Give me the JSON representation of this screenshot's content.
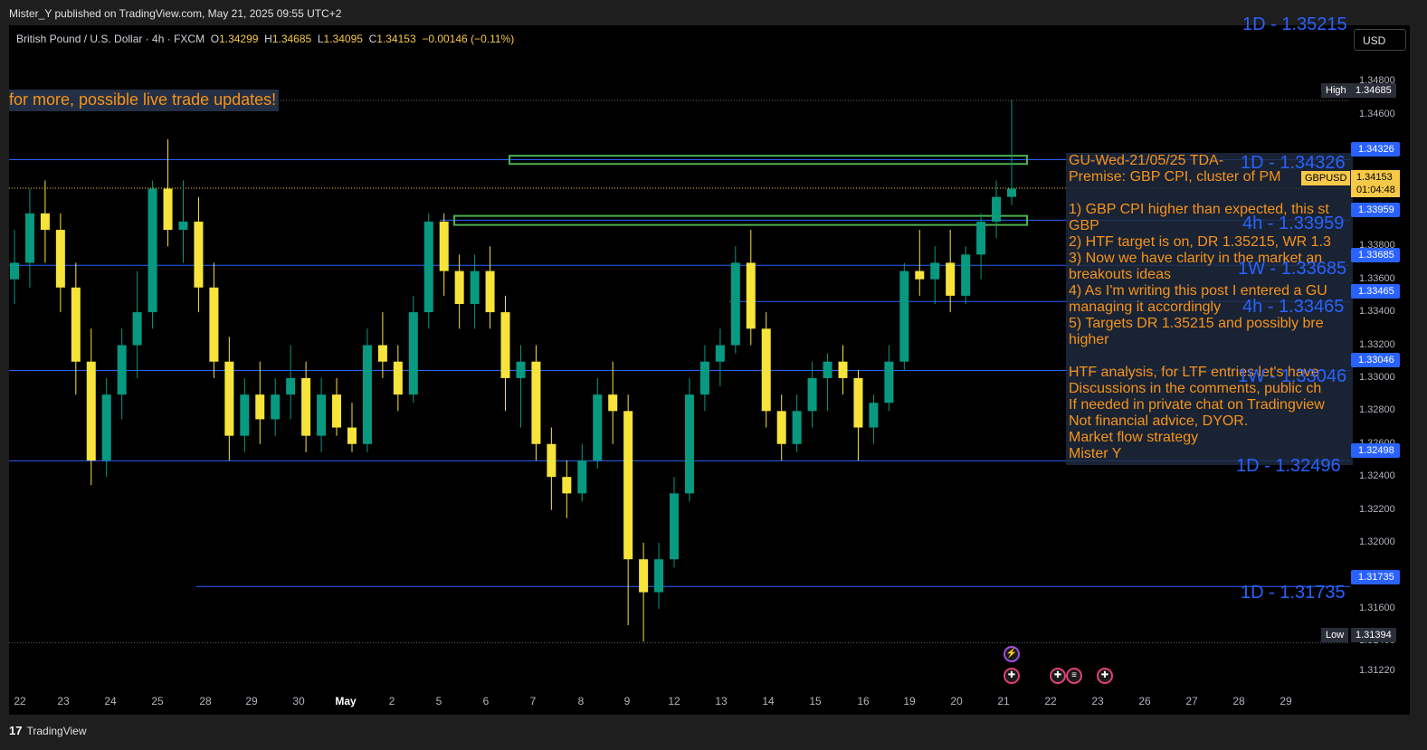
{
  "header": {
    "publisher_text": "Mister_Y published on TradingView.com, May 21, 2025 09:55 UTC+2"
  },
  "footer": {
    "logo_text": "TradingView",
    "logo_mark": "17"
  },
  "legend": {
    "symbol": "British Pound / U.S. Dollar · 4h · FXCM",
    "open": "1.34299",
    "high": "1.34685",
    "low": "1.34095",
    "close": "1.34153",
    "change": "−0.00146 (−0.11%)"
  },
  "currency_button": "USD",
  "promo_text": "for more, possible live trade updates!",
  "note": {
    "lines": [
      "GU-Wed-21/05/25 TDA-",
      "Premise: GBP CPI, cluster of PM",
      "",
      "1) GBP CPI higher than expected, this st",
      "GBP",
      "2) HTF target is on, DR 1.35215, WR 1.3",
      "3) Now we have clarity in the market an",
      "breakouts ideas",
      "4) As I'm writing this post I entered a GU",
      "managing it accordingly",
      "5) Targets DR 1.35215 and possibly bre",
      "higher",
      "",
      "HTF analysis, for LTF entries let's have",
      "Discussions in the comments, public ch",
      "If needed in private chat on Tradingview",
      "Not financial advice, DYOR.",
      "Market flow strategy",
      "Mister Y"
    ]
  },
  "level_labels": [
    {
      "text": "1D - 1.34326"
    },
    {
      "text": "4h - 1.33959"
    },
    {
      "text": "1W - 1.33685"
    },
    {
      "text": "4h - 1.33465"
    },
    {
      "text": "1W - 1.33046"
    },
    {
      "text": "1D - 1.32496"
    },
    {
      "text": "1D - 1.31735"
    },
    {
      "text": "1D - 1.35215"
    }
  ],
  "price_axis": {
    "ticks": [
      "1.34800",
      "1.34600",
      "1.34400",
      "1.34200",
      "1.34000",
      "1.33800",
      "1.33600",
      "1.33400",
      "1.33200",
      "1.33000",
      "1.32800",
      "1.32600",
      "1.32400",
      "1.32200",
      "1.32000",
      "1.31800",
      "1.31600",
      "1.31400",
      "1.31220"
    ],
    "tags": [
      "1.34326",
      "1.33959",
      "1.33685",
      "1.33465",
      "1.33046",
      "1.32498",
      "1.31735"
    ],
    "high_label": "High",
    "high_value": "1.34685",
    "low_label": "Low",
    "low_value": "1.31394",
    "symbol_tag": "GBPUSD",
    "current_price": "1.34153",
    "countdown": "01:04:48"
  },
  "time_axis": [
    "22",
    "23",
    "24",
    "25",
    "28",
    "29",
    "30",
    "May",
    "2",
    "5",
    "6",
    "7",
    "8",
    "9",
    "12",
    "13",
    "14",
    "15",
    "16",
    "19",
    "20",
    "21",
    "22",
    "23",
    "26",
    "27",
    "28",
    "29"
  ],
  "colors": {
    "bull": "#089981",
    "bear": "#f7e43a",
    "level": "#2962ff",
    "zone": "#4caf50",
    "accent": "#f7931a"
  },
  "chart_data": {
    "type": "candlestick",
    "title": "British Pound / U.S. Dollar · 4h · FXCM",
    "ylim": [
      1.3122,
      1.349
    ],
    "x_labels": [
      "22",
      "23",
      "24",
      "25",
      "28",
      "29",
      "30",
      "May",
      "2",
      "5",
      "6",
      "7",
      "8",
      "9",
      "12",
      "13",
      "14",
      "15",
      "16",
      "19",
      "20",
      "21"
    ],
    "ohlc_estimated": [
      [
        1.336,
        1.339,
        1.3345,
        1.337
      ],
      [
        1.337,
        1.3415,
        1.3355,
        1.34
      ],
      [
        1.34,
        1.342,
        1.337,
        1.339
      ],
      [
        1.339,
        1.34,
        1.334,
        1.3355
      ],
      [
        1.3355,
        1.337,
        1.329,
        1.331
      ],
      [
        1.331,
        1.333,
        1.3235,
        1.325
      ],
      [
        1.325,
        1.33,
        1.324,
        1.329
      ],
      [
        1.329,
        1.333,
        1.3275,
        1.332
      ],
      [
        1.332,
        1.3365,
        1.33,
        1.334
      ],
      [
        1.334,
        1.342,
        1.333,
        1.3415
      ],
      [
        1.3415,
        1.3445,
        1.338,
        1.339
      ],
      [
        1.339,
        1.342,
        1.337,
        1.3395
      ],
      [
        1.3395,
        1.341,
        1.334,
        1.3355
      ],
      [
        1.3355,
        1.337,
        1.33,
        1.331
      ],
      [
        1.331,
        1.3325,
        1.325,
        1.3265
      ],
      [
        1.3265,
        1.33,
        1.3255,
        1.329
      ],
      [
        1.329,
        1.331,
        1.326,
        1.3275
      ],
      [
        1.3275,
        1.33,
        1.3265,
        1.329
      ],
      [
        1.329,
        1.332,
        1.3275,
        1.33
      ],
      [
        1.33,
        1.331,
        1.3255,
        1.3265
      ],
      [
        1.3265,
        1.33,
        1.3255,
        1.329
      ],
      [
        1.329,
        1.33,
        1.3265,
        1.327
      ],
      [
        1.327,
        1.3285,
        1.3255,
        1.326
      ],
      [
        1.326,
        1.333,
        1.3255,
        1.332
      ],
      [
        1.332,
        1.334,
        1.33,
        1.331
      ],
      [
        1.331,
        1.332,
        1.328,
        1.329
      ],
      [
        1.329,
        1.335,
        1.3285,
        1.334
      ],
      [
        1.334,
        1.34,
        1.333,
        1.3395
      ],
      [
        1.3395,
        1.34,
        1.335,
        1.3365
      ],
      [
        1.3365,
        1.3375,
        1.333,
        1.3345
      ],
      [
        1.3345,
        1.3375,
        1.333,
        1.3365
      ],
      [
        1.3365,
        1.338,
        1.333,
        1.334
      ],
      [
        1.334,
        1.335,
        1.328,
        1.33
      ],
      [
        1.33,
        1.332,
        1.327,
        1.331
      ],
      [
        1.331,
        1.332,
        1.325,
        1.326
      ],
      [
        1.326,
        1.327,
        1.322,
        1.324
      ],
      [
        1.324,
        1.325,
        1.3215,
        1.323
      ],
      [
        1.323,
        1.326,
        1.3225,
        1.325
      ],
      [
        1.325,
        1.33,
        1.3245,
        1.329
      ],
      [
        1.329,
        1.331,
        1.326,
        1.328
      ],
      [
        1.328,
        1.329,
        1.315,
        1.319
      ],
      [
        1.319,
        1.32,
        1.314,
        1.317
      ],
      [
        1.317,
        1.32,
        1.316,
        1.319
      ],
      [
        1.319,
        1.324,
        1.3185,
        1.323
      ],
      [
        1.323,
        1.33,
        1.3225,
        1.329
      ],
      [
        1.329,
        1.332,
        1.328,
        1.331
      ],
      [
        1.331,
        1.333,
        1.3295,
        1.332
      ],
      [
        1.332,
        1.338,
        1.3315,
        1.337
      ],
      [
        1.337,
        1.339,
        1.332,
        1.333
      ],
      [
        1.333,
        1.334,
        1.327,
        1.328
      ],
      [
        1.328,
        1.329,
        1.325,
        1.326
      ],
      [
        1.326,
        1.329,
        1.3255,
        1.328
      ],
      [
        1.328,
        1.331,
        1.327,
        1.33
      ],
      [
        1.33,
        1.3315,
        1.328,
        1.331
      ],
      [
        1.331,
        1.332,
        1.329,
        1.33
      ],
      [
        1.33,
        1.3305,
        1.325,
        1.327
      ],
      [
        1.327,
        1.329,
        1.326,
        1.3285
      ],
      [
        1.3285,
        1.332,
        1.328,
        1.331
      ],
      [
        1.331,
        1.337,
        1.3305,
        1.3365
      ],
      [
        1.3365,
        1.339,
        1.335,
        1.336
      ],
      [
        1.336,
        1.338,
        1.3345,
        1.337
      ],
      [
        1.337,
        1.339,
        1.334,
        1.335
      ],
      [
        1.335,
        1.338,
        1.3345,
        1.3375
      ],
      [
        1.3375,
        1.34,
        1.336,
        1.3395
      ],
      [
        1.3395,
        1.342,
        1.3385,
        1.341
      ],
      [
        1.341,
        1.3469,
        1.3405,
        1.3415
      ]
    ],
    "horizontal_levels": [
      1.34326,
      1.33959,
      1.33685,
      1.33465,
      1.33046,
      1.32498,
      1.31735
    ],
    "zones": [
      [
        1.343,
        1.3435
      ],
      [
        1.3393,
        1.33985
      ]
    ],
    "high": 1.34685,
    "low": 1.31394,
    "current": 1.34153
  }
}
